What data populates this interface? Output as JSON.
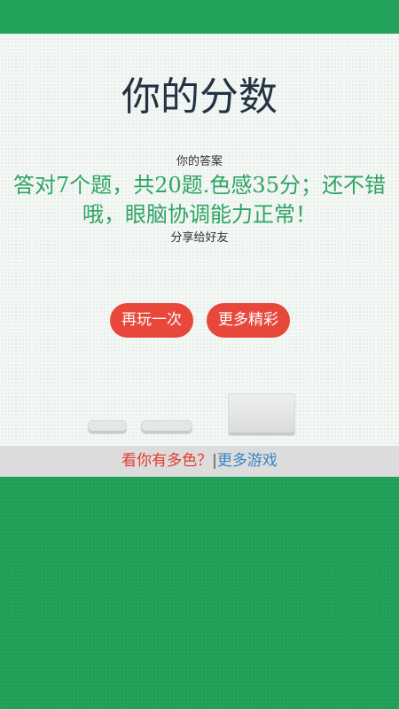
{
  "page": {
    "title": "你的分数",
    "answer_label": "你的答案",
    "result": "答对7个题，共20题.色感35分；还不错哦，眼脑协调能力正常！",
    "share_label": "分享给好友"
  },
  "buttons": {
    "replay": "再玩一次",
    "more": "更多精彩"
  },
  "footer": {
    "promo": "看你有多色？",
    "separator": "|",
    "more_games": "更多游戏"
  },
  "colors": {
    "background_green": "#22a35b",
    "button_red": "#e8473c",
    "result_green": "#2fa463",
    "link_blue": "#3a86c4",
    "promo_red": "#e53b2f"
  }
}
